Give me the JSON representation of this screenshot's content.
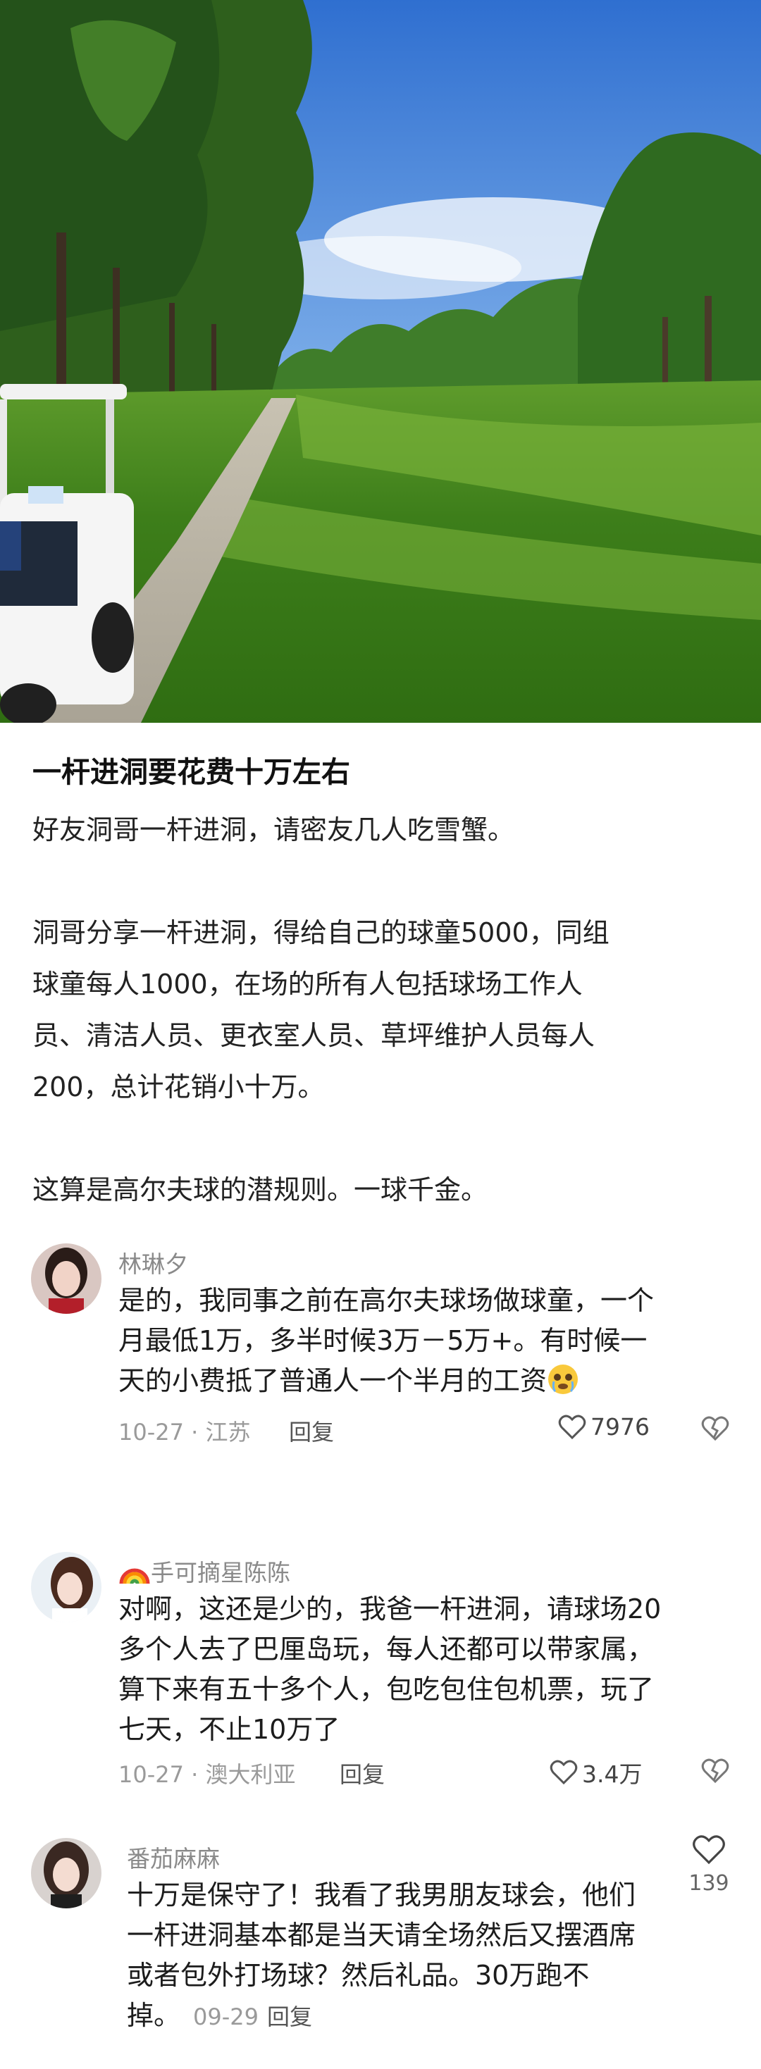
{
  "post": {
    "title": "一杆进洞要花费十万左右",
    "lines": [
      "好友洞哥一杆进洞，请密友几人吃雪蟹。",
      "",
      "洞哥分享一杆进洞，得给自己的球童5000，同组",
      "球童每人1000，在场的所有人包括球场工作人",
      "员、清洁人员、更衣室人员、草坪维护人员每人",
      "200，总计花销小十万。",
      "",
      "这算是高尔夫球的潜规则。一球千金。"
    ]
  },
  "comments": [
    {
      "name": "林琳夕",
      "lines": [
        "是的，我同事之前在高尔夫球场做球童，一个",
        "月最低1万，多半时候3万－5万+。有时候一",
        "天的小费抵了普通人一个半月的工资"
      ],
      "date": "10-27 · 江苏",
      "reply": "回复",
      "likes": "7976"
    },
    {
      "name": "手可摘星陈陈",
      "lines": [
        "对啊，这还是少的，我爸一杆进洞，请球场20",
        "多个人去了巴厘岛玩，每人还都可以带家属，",
        "算下来有五十多个人，包吃包住包机票，玩了",
        "七天，不止10万了"
      ],
      "date": "10-27 · 澳大利亚",
      "reply": "回复",
      "likes": "3.4万"
    },
    {
      "name": "番茄麻麻",
      "lines": [
        "十万是保守了！我看了我男朋友球会，他们",
        "一杆进洞基本都是当天请全场然后又摆酒席",
        "或者包外打场球？然后礼品。30万跑不",
        "掉。"
      ],
      "date": "09-29",
      "reply": "回复",
      "likes": "139"
    }
  ],
  "icons": {
    "heart": "heart-icon",
    "dislike": "broken-heart-icon",
    "rainbow": "rainbow-emoji-icon",
    "crying": "crying-face-emoji-icon"
  },
  "colors": {
    "meta_gray": "#9a9a9a",
    "name_gray": "#8a8a8a",
    "text": "#1c1c1c"
  }
}
